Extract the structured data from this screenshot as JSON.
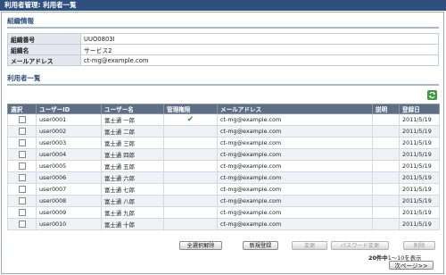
{
  "window_title": "利用者管理: 利用者一覧",
  "org_section": {
    "heading": "組織情報",
    "rows": [
      {
        "label": "組織番号",
        "value": "UUO0803I"
      },
      {
        "label": "組織名",
        "value": "サービス2"
      },
      {
        "label": "メールアドレス",
        "value": "ct-mg@example.com"
      }
    ]
  },
  "users_section": {
    "heading": "利用者一覧",
    "refresh_icon": "refresh-icon",
    "columns": [
      "選択",
      "ユーザーID",
      "ユーザー名",
      "管理権限",
      "メールアドレス",
      "説明",
      "登録日"
    ],
    "rows": [
      {
        "id": "user0001",
        "name": "富士通 一郎",
        "admin": true,
        "email": "ct-mg@example.com",
        "desc": "",
        "date": "2011/5/19"
      },
      {
        "id": "user0002",
        "name": "富士通 二郎",
        "admin": false,
        "email": "ct-mg@example.com",
        "desc": "",
        "date": "2011/5/19"
      },
      {
        "id": "user0003",
        "name": "富士通 三郎",
        "admin": false,
        "email": "ct-mg@example.com",
        "desc": "",
        "date": "2011/5/19"
      },
      {
        "id": "user0004",
        "name": "富士通 四郎",
        "admin": false,
        "email": "ct-mg@example.com",
        "desc": "",
        "date": "2011/5/19"
      },
      {
        "id": "user0005",
        "name": "富士通 五郎",
        "admin": false,
        "email": "ct-mg@example.com",
        "desc": "",
        "date": "2011/5/19"
      },
      {
        "id": "user0006",
        "name": "富士通 六郎",
        "admin": false,
        "email": "ct-mg@example.com",
        "desc": "",
        "date": "2011/5/19"
      },
      {
        "id": "user0007",
        "name": "富士通 七郎",
        "admin": false,
        "email": "ct-mg@example.com",
        "desc": "",
        "date": "2011/5/19"
      },
      {
        "id": "user0008",
        "name": "富士通 八郎",
        "admin": false,
        "email": "ct-mg@example.com",
        "desc": "",
        "date": "2011/5/19"
      },
      {
        "id": "user0009",
        "name": "富士通 九郎",
        "admin": false,
        "email": "ct-mg@example.com",
        "desc": "",
        "date": "2011/5/19"
      },
      {
        "id": "user0010",
        "name": "富士通 十郎",
        "admin": false,
        "email": "ct-mg@example.com",
        "desc": "",
        "date": "2011/5/19"
      }
    ]
  },
  "actions": {
    "select_all": "全選択解除",
    "new": "新規登録",
    "edit": "変更",
    "password": "パスワード変更",
    "delete": "削除"
  },
  "pagination": {
    "total": "20件中",
    "range": "1〜10を表示",
    "next": "次ページ>>"
  },
  "colors": {
    "title_bar": "#2f4f7f",
    "table_header": "#5e6e85",
    "admin_check": "#2e9a2e"
  }
}
